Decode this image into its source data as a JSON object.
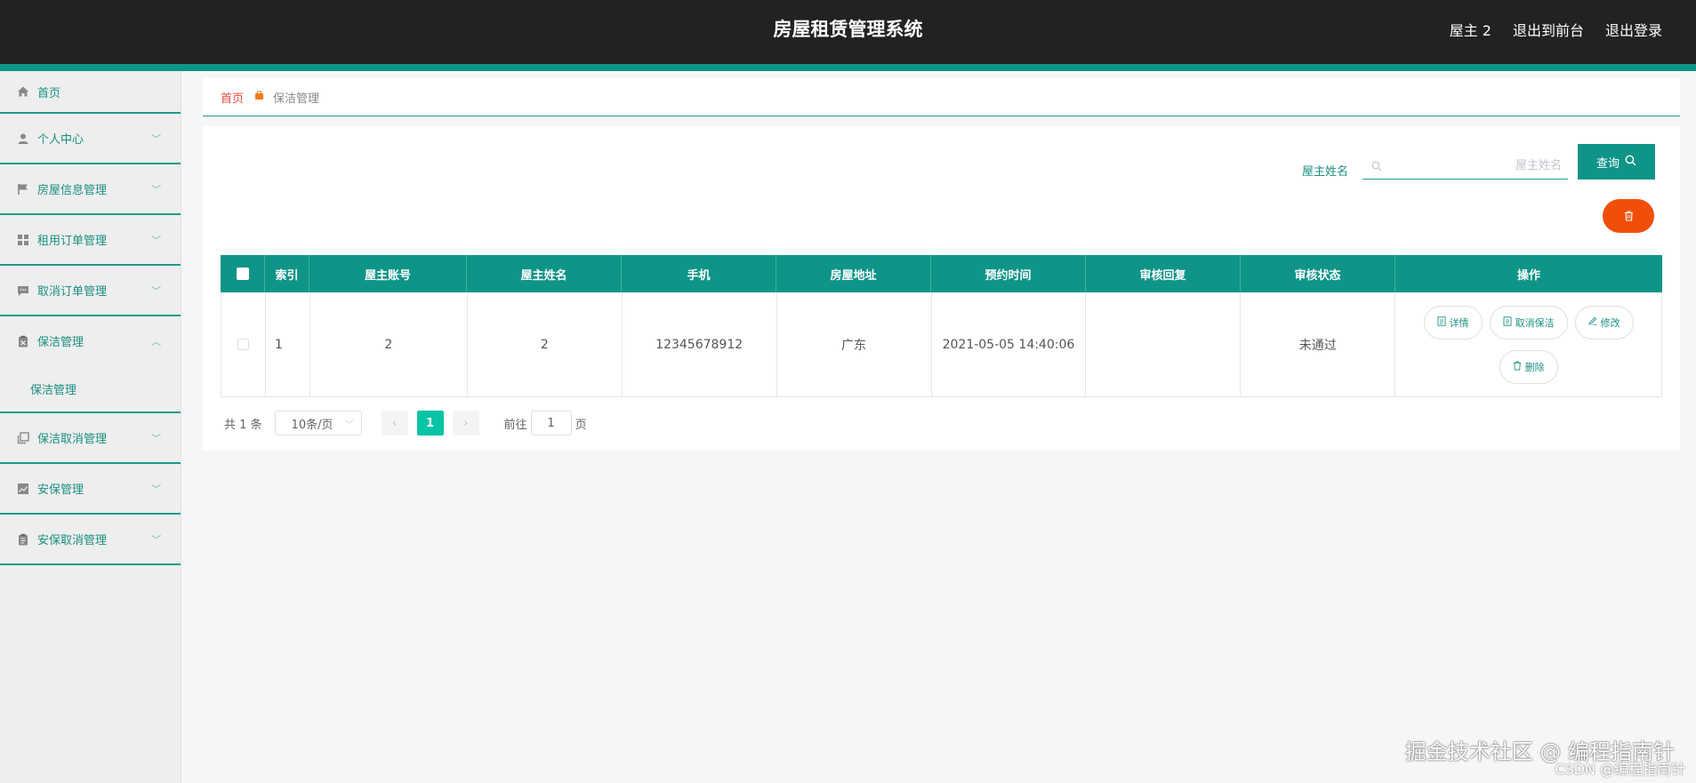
{
  "header": {
    "title": "房屋租赁管理系统",
    "user": "屋主 2",
    "back_to_front": "退出到前台",
    "logout": "退出登录"
  },
  "sidebar": {
    "items": [
      {
        "label": "首页",
        "icon": "home-icon"
      },
      {
        "label": "个人中心",
        "icon": "user-icon"
      },
      {
        "label": "房屋信息管理",
        "icon": "flag-icon"
      },
      {
        "label": "租用订单管理",
        "icon": "grid-icon"
      },
      {
        "label": "取消订单管理",
        "icon": "chat-icon"
      },
      {
        "label": "保洁管理",
        "icon": "clipboard-icon",
        "expanded": true,
        "children": [
          "保洁管理"
        ]
      },
      {
        "label": "保洁取消管理",
        "icon": "copy-icon"
      },
      {
        "label": "安保管理",
        "icon": "chart-icon"
      },
      {
        "label": "安保取消管理",
        "icon": "clipboard-list-icon"
      }
    ]
  },
  "breadcrumb": {
    "home": "首页",
    "current": "保洁管理"
  },
  "search": {
    "label": "屋主姓名",
    "placeholder": "屋主姓名",
    "value": "",
    "button": "查询"
  },
  "table": {
    "columns": [
      "索引",
      "屋主账号",
      "屋主姓名",
      "手机",
      "房屋地址",
      "预约时间",
      "审核回复",
      "审核状态",
      "操作"
    ],
    "rows": [
      {
        "index": "1",
        "account": "2",
        "name": "2",
        "phone": "12345678912",
        "address": "广东",
        "time": "2021-05-05 14:40:06",
        "reply": "",
        "status": "未通过",
        "actions": {
          "detail": "详情",
          "cancel": "取消保洁",
          "edit": "修改",
          "delete": "删除"
        }
      }
    ]
  },
  "pagination": {
    "total": "共 1 条",
    "page_size": "10条/页",
    "current_page": "1",
    "goto_prefix": "前往",
    "goto_value": "1",
    "goto_suffix": "页"
  },
  "watermark": {
    "line1": "掘金技术社区 @ 编程指南针",
    "line2": "CSDN @编程指南针"
  },
  "colors": {
    "header_bg": "#222222",
    "accent": "#0f9488",
    "danger": "#f14e0a",
    "page_active": "#07c4a6"
  }
}
